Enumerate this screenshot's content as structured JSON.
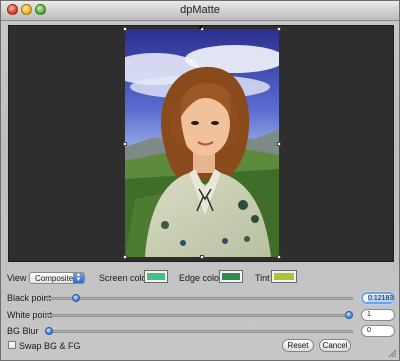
{
  "window": {
    "title": "dpMatte"
  },
  "controls": {
    "view_label": "View",
    "view_value": "Composite",
    "screen_color_label": "Screen color",
    "screen_color": "#3fc484",
    "edge_color_label": "Edge color",
    "edge_color": "#2f8a4d",
    "tint_label": "Tint",
    "tint_color": "#b3c233"
  },
  "sliders": [
    {
      "label": "Black point",
      "value": "0.12183",
      "fraction": 0.09
    },
    {
      "label": "White point",
      "value": "1",
      "fraction": 1.0
    },
    {
      "label": "BG Blur",
      "value": "0",
      "fraction": 0.0
    }
  ],
  "footer": {
    "swap_label": "Swap BG & FG",
    "swap_checked": false,
    "reset_label": "Reset",
    "cancel_label": "Cancel"
  }
}
